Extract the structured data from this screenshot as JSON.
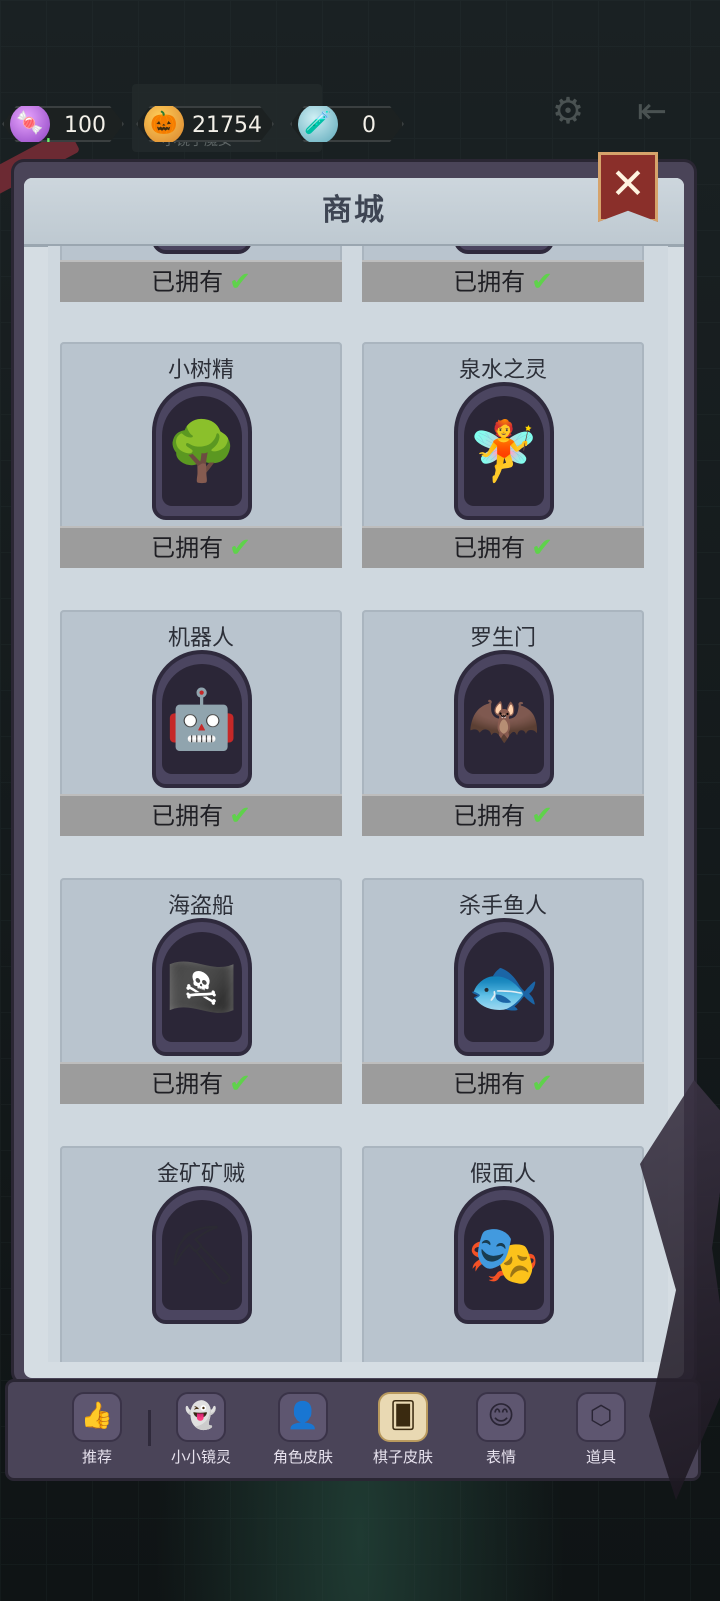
{
  "currencies": [
    {
      "name": "candy-icon",
      "value": "100"
    },
    {
      "name": "pumpkin-icon",
      "value": "21754"
    },
    {
      "name": "potion-icon",
      "value": "0"
    }
  ],
  "behind_tab_label": "小镜子魔女",
  "shop": {
    "title": "商城",
    "owned_label": "已拥有",
    "items": [
      {
        "name": "",
        "owned": true,
        "icon": "🪵"
      },
      {
        "name": "",
        "owned": true,
        "icon": "💧"
      },
      {
        "name": "小树精",
        "owned": true,
        "icon": "🌳"
      },
      {
        "name": "泉水之灵",
        "owned": true,
        "icon": "🧚"
      },
      {
        "name": "机器人",
        "owned": true,
        "icon": "🤖"
      },
      {
        "name": "罗生门",
        "owned": true,
        "icon": "🦇"
      },
      {
        "name": "海盗船",
        "owned": true,
        "icon": "🏴‍☠️"
      },
      {
        "name": "杀手鱼人",
        "owned": true,
        "icon": "🐟"
      },
      {
        "name": "金矿矿贼",
        "owned": false,
        "icon": "⛏"
      },
      {
        "name": "假面人",
        "owned": false,
        "icon": "🎭"
      }
    ]
  },
  "nav": {
    "items": [
      {
        "label": "推荐",
        "icon": "👍"
      },
      {
        "label": "小小镜灵",
        "icon": "👻"
      },
      {
        "label": "角色皮肤",
        "icon": "👤"
      },
      {
        "label": "棋子皮肤",
        "icon": "🂠"
      },
      {
        "label": "表情",
        "icon": "😊"
      },
      {
        "label": "道具",
        "icon": "⬡"
      }
    ],
    "active_index": 3
  },
  "colors": {
    "panel": "#4a4458",
    "card": "#b9c4ce",
    "owned_bar": "#9c9c9c",
    "check": "#5fd24b",
    "close_button": "#8a2f2a"
  }
}
